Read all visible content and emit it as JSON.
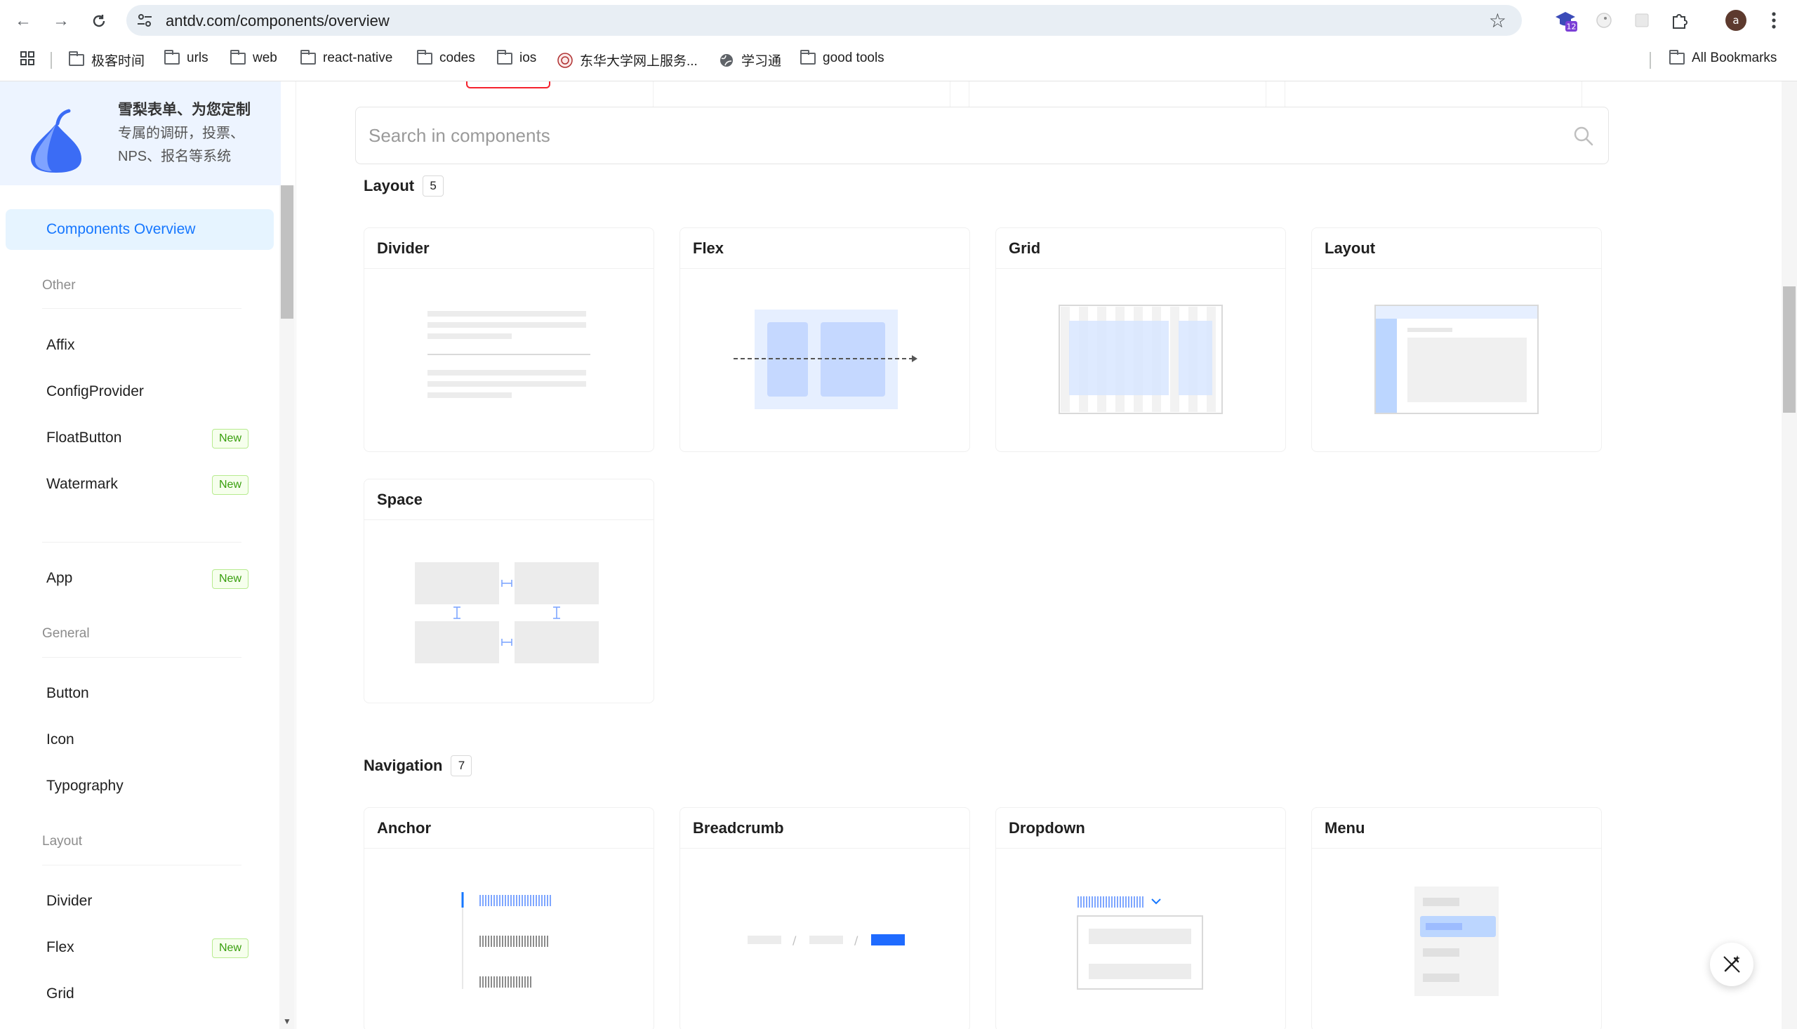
{
  "browser": {
    "url": "antdv.com/components/overview",
    "extension_badge": "12",
    "profile_initial": "a",
    "bookmarks": [
      {
        "label": "极客时间",
        "icon": "folder-icon"
      },
      {
        "label": "urls",
        "icon": "folder-icon"
      },
      {
        "label": "web",
        "icon": "folder-icon"
      },
      {
        "label": "react-native",
        "icon": "folder-icon"
      },
      {
        "label": "codes",
        "icon": "folder-icon"
      },
      {
        "label": "ios",
        "icon": "folder-icon"
      },
      {
        "label": "东华大学网上服务...",
        "icon": "university-logo-icon"
      },
      {
        "label": "学习通",
        "icon": "globe-icon"
      },
      {
        "label": "good tools",
        "icon": "folder-icon"
      }
    ],
    "all_bookmarks": "All Bookmarks"
  },
  "sidebar": {
    "promo": {
      "title": "雪梨表单、为您定制",
      "text": "专属的调研，投票、NPS、报名等系统"
    },
    "overview_label": "Components Overview",
    "new_badge": "New",
    "groups": {
      "other": "Other",
      "general": "General",
      "layout": "Layout"
    },
    "items": {
      "affix": "Affix",
      "configprovider": "ConfigProvider",
      "floatbutton": "FloatButton",
      "watermark": "Watermark",
      "app": "App",
      "button": "Button",
      "icon": "Icon",
      "typography": "Typography",
      "divider": "Divider",
      "flex": "Flex",
      "grid": "Grid"
    }
  },
  "main": {
    "search": {
      "placeholder": "Search in components"
    },
    "layout_section": {
      "title": "Layout",
      "count": "5",
      "cards": [
        "Divider",
        "Flex",
        "Grid",
        "Layout",
        "Space"
      ]
    },
    "navigation_section": {
      "title": "Navigation",
      "count": "7",
      "cards": [
        "Anchor",
        "Breadcrumb",
        "Dropdown",
        "Menu"
      ]
    }
  },
  "colors": {
    "primary": "#1677ff",
    "active_bg": "#e6f4ff",
    "promo_bg": "#edf4ff",
    "new_badge_text": "#389e0d",
    "new_badge_bg": "#f6ffed",
    "new_badge_border": "#b7eb8f"
  }
}
